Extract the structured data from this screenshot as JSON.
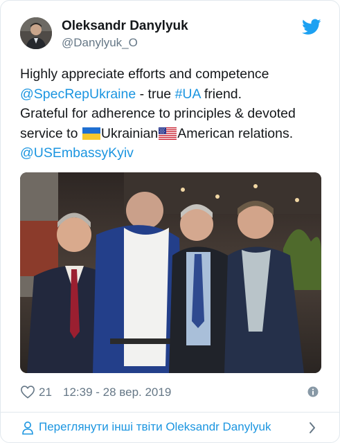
{
  "author": {
    "name": "Oleksandr Danylyuk",
    "handle": "@Danylyuk_O",
    "avatar_icon": "profile-photo"
  },
  "brand": {
    "icon": "twitter-bird-icon",
    "color": "#1da1f2"
  },
  "tweet": {
    "line1": "Highly appreciate efforts and competence",
    "mention1": "@SpecRepUkraine",
    "line2_mid": " - true ",
    "hashtag": "#UA",
    "line2_end": " friend.",
    "line3": "Grateful for adherence to principles & devoted",
    "line4_start": "service to ",
    "flag1": "ukraine-flag",
    "line4_mid": "Ukrainian",
    "flag2": "usa-flag",
    "line4_end": "American relations.",
    "mention2": "@USEmbassyKyiv"
  },
  "media": {
    "icon": "group-photo"
  },
  "meta": {
    "likes": "21",
    "timestamp": "12:39 - 28 вер. 2019"
  },
  "footer": {
    "label": "Переглянути інші твіти Oleksandr Danylyuk"
  },
  "colors": {
    "link": "#1b95e0",
    "text": "#14171a",
    "secondary": "#657786",
    "border": "#e1e8ed"
  }
}
